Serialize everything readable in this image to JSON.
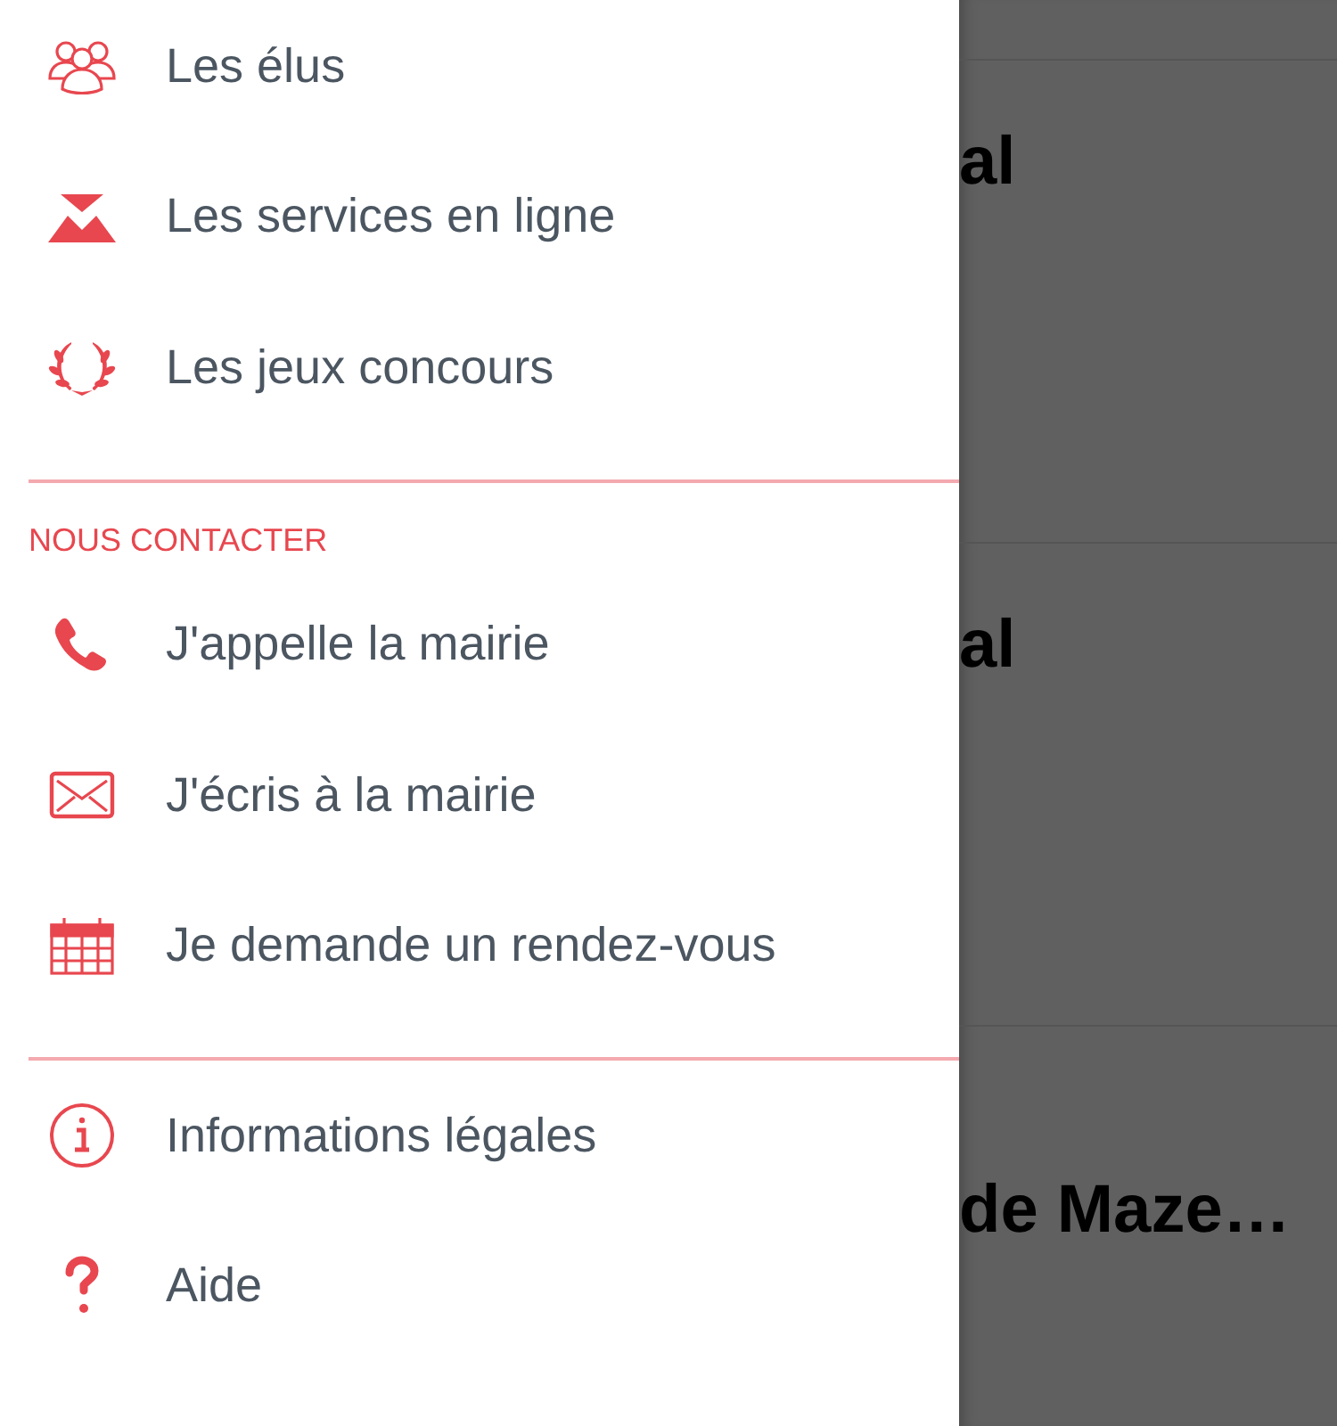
{
  "menu": [
    {
      "items": [
        {
          "label": "Les élus",
          "kind": "people"
        },
        {
          "label": "Les services en ligne",
          "kind": "services"
        },
        {
          "label": "Les jeux concours",
          "kind": "laurel"
        }
      ]
    },
    {
      "header": "NOUS CONTACTER",
      "items": [
        {
          "label": "J'appelle la mairie",
          "kind": "phone"
        },
        {
          "label": "J'écris à la mairie",
          "kind": "mail"
        },
        {
          "label": "Je demande un rendez-vous",
          "kind": "calendar"
        }
      ]
    },
    {
      "items": [
        {
          "label": "Informations légales",
          "kind": "info"
        },
        {
          "label": "Aide",
          "kind": "help"
        }
      ]
    }
  ],
  "background_cards": [
    {
      "title": "al"
    },
    {
      "title": "al"
    },
    {
      "title": "de Maze…"
    }
  ]
}
